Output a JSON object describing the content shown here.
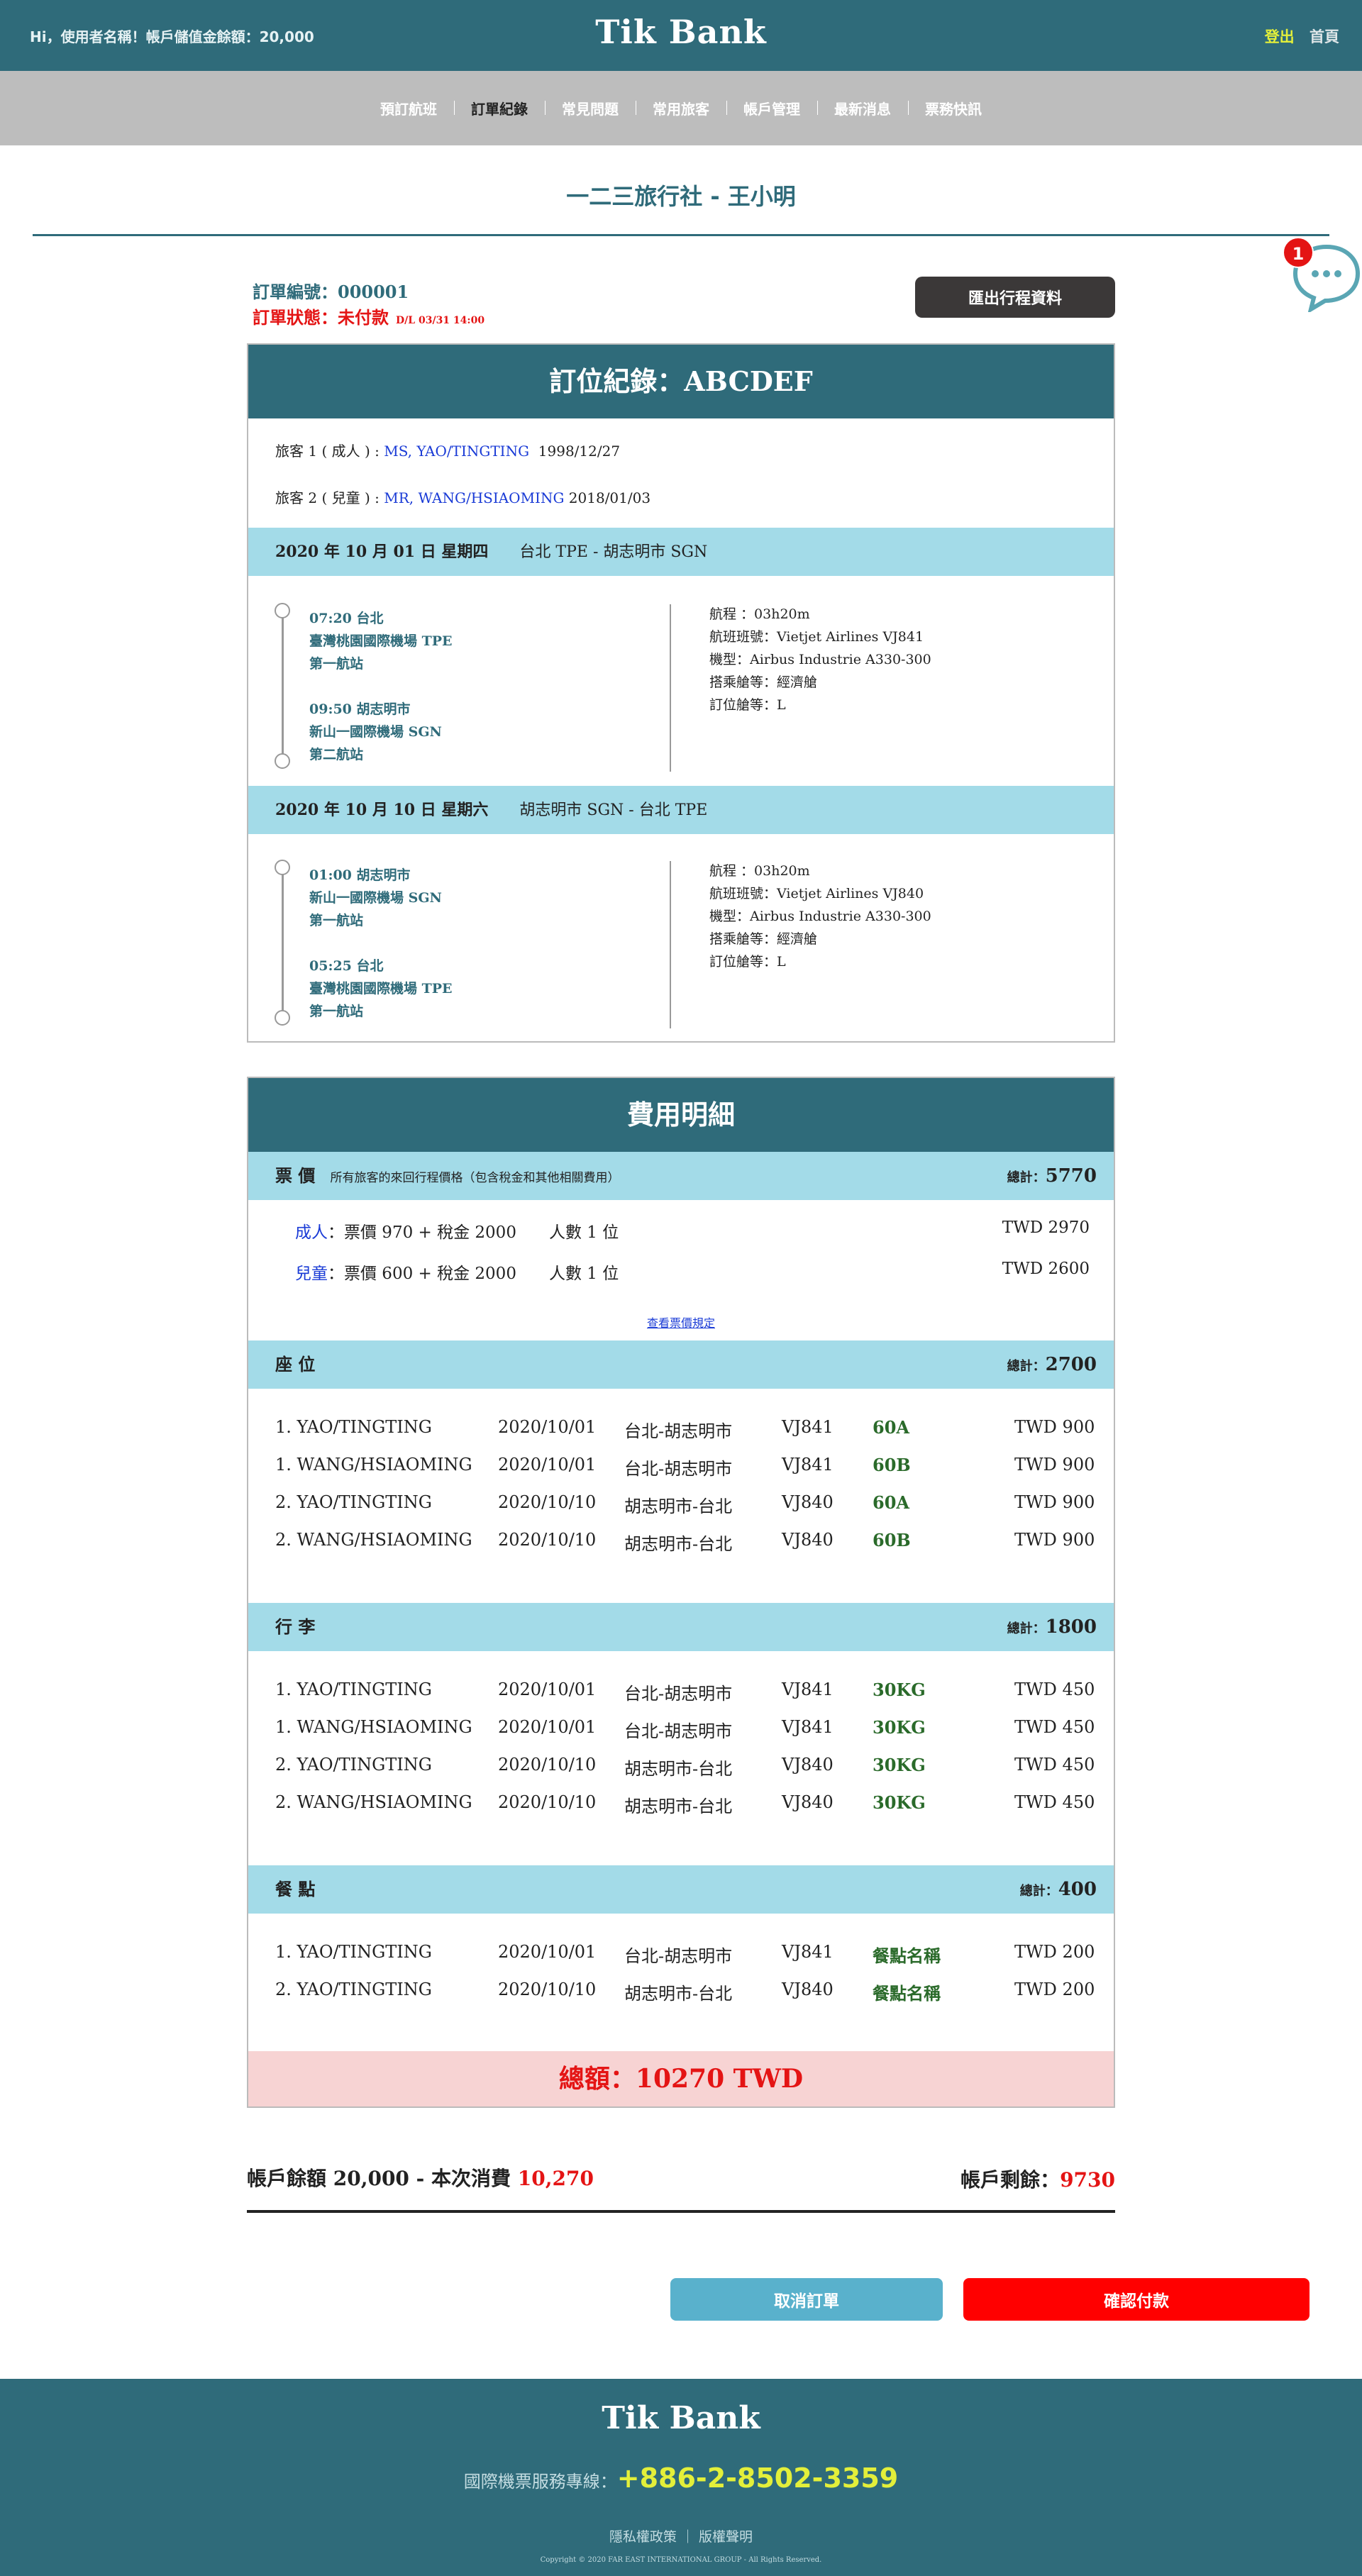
{
  "header": {
    "greeting": "Hi，使用者名稱！帳戶儲值金餘額：20,000",
    "logo": "Tik Bank",
    "logout": "登出",
    "home": "首頁"
  },
  "nav": [
    "預訂航班",
    "訂單紀錄",
    "常見問題",
    "常用旅客",
    "帳戶管理",
    "最新消息",
    "票務快訊"
  ],
  "nav_active": "訂單紀錄",
  "page_title": "一二三旅行社 - 王小明",
  "chat": {
    "badge": "1"
  },
  "order": {
    "number": "訂單編號：000001",
    "status": "訂單狀態：未付款",
    "deadline": "D/L 03/31 14:00",
    "export_button": "匯出行程資料"
  },
  "booking": {
    "title": "訂位紀錄：ABCDEF",
    "passengers": [
      {
        "label": "旅客 1 ( 成人 ) : ",
        "name": "MS, YAO/TINGTING",
        "dob": "1998/12/27"
      },
      {
        "label": "旅客 2 ( 兒童 ) : ",
        "name": "MR, WANG/HSIAOMING",
        "dob": "2018/01/03"
      }
    ],
    "segments": [
      {
        "date": "2020 年 10 月 01 日 星期四",
        "route": "台北 TPE - 胡志明市 SGN",
        "dep": {
          "time_city": "07:20 台北",
          "airport": "臺灣桃園國際機場 TPE",
          "terminal": "第一航站"
        },
        "arr": {
          "time_city": "09:50 胡志明市",
          "airport": "新山一國際機場 SGN",
          "terminal": "第二航站"
        },
        "info": [
          "航程 ：03h20m",
          "航班班號：Vietjet Airlines VJ841",
          "機型：Airbus Industrie A330-300",
          "搭乘艙等：經濟艙",
          "訂位艙等：L"
        ]
      },
      {
        "date": "2020 年 10 月 10 日 星期六",
        "route": "胡志明市 SGN - 台北 TPE",
        "dep": {
          "time_city": "01:00 胡志明市",
          "airport": "新山一國際機場 SGN",
          "terminal": "第一航站"
        },
        "arr": {
          "time_city": "05:25 台北",
          "airport": "臺灣桃園國際機場 TPE",
          "terminal": "第一航站"
        },
        "info": [
          "航程 ：03h20m",
          "航班班號：Vietjet Airlines VJ840",
          "機型：Airbus Industrie A330-300",
          "搭乘艙等：經濟艙",
          "訂位艙等：L"
        ]
      }
    ]
  },
  "costs": {
    "title": "費用明細",
    "total_label": "總計：",
    "fare": {
      "title": "票 價",
      "note": "所有旅客的來回行程價格（包含稅金和其他相關費用）",
      "total": "5770",
      "rows": [
        {
          "type": "成人",
          "detail": "：票價 970 + 稅金 2000　　人數 1 位",
          "amount": "TWD 2970"
        },
        {
          "type": "兒童",
          "detail": "：票價 600 + 稅金 2000　　人數 1 位",
          "amount": "TWD 2600"
        }
      ],
      "link": "查看票價規定"
    },
    "seat": {
      "title": "座 位",
      "total": "2700",
      "rows": [
        [
          "1. YAO/TINGTING",
          "2020/10/01",
          "台北-胡志明市",
          "VJ841",
          "60A",
          "TWD 900"
        ],
        [
          "1. WANG/HSIAOMING",
          "2020/10/01",
          "台北-胡志明市",
          "VJ841",
          "60B",
          "TWD 900"
        ],
        [
          "2. YAO/TINGTING",
          "2020/10/10",
          "胡志明市-台北",
          "VJ840",
          "60A",
          "TWD 900"
        ],
        [
          "2. WANG/HSIAOMING",
          "2020/10/10",
          "胡志明市-台北",
          "VJ840",
          "60B",
          "TWD 900"
        ]
      ]
    },
    "baggage": {
      "title": "行 李",
      "total": "1800",
      "rows": [
        [
          "1. YAO/TINGTING",
          "2020/10/01",
          "台北-胡志明市",
          "VJ841",
          "30KG",
          "TWD 450"
        ],
        [
          "1. WANG/HSIAOMING",
          "2020/10/01",
          "台北-胡志明市",
          "VJ841",
          "30KG",
          "TWD 450"
        ],
        [
          "2. YAO/TINGTING",
          "2020/10/10",
          "胡志明市-台北",
          "VJ840",
          "30KG",
          "TWD 450"
        ],
        [
          "2. WANG/HSIAOMING",
          "2020/10/10",
          "胡志明市-台北",
          "VJ840",
          "30KG",
          "TWD 450"
        ]
      ]
    },
    "meal": {
      "title": "餐 點",
      "total": "400",
      "rows": [
        [
          "1. YAO/TINGTING",
          "2020/10/01",
          "台北-胡志明市",
          "VJ841",
          "餐點名稱",
          "TWD 200"
        ],
        [
          "2. YAO/TINGTING",
          "2020/10/10",
          "胡志明市-台北",
          "VJ840",
          "餐點名稱",
          "TWD 200"
        ]
      ]
    },
    "grand_total": "總額：10270 TWD"
  },
  "balance": {
    "left_prefix": "帳戶餘額 20,000 - 本次消費 ",
    "spend": "10,270",
    "right_prefix": "帳戶剩餘：",
    "remaining": "9730"
  },
  "buttons": {
    "cancel": "取消訂單",
    "confirm": "確認付款"
  },
  "footer": {
    "logo": "Tik Bank",
    "phone_label": "國際機票服務專線：",
    "phone": "+886-2-8502-3359",
    "privacy": "隱私權政策",
    "sep": "｜",
    "copyright_link": "版權聲明",
    "copyright": "Copyright © 2020 FAR EAST INTERNATIONAL GROUP - All Rights Reserved."
  },
  "colors": {
    "brand": "#2f6b7a",
    "accent_yellow": "#e3ef3a",
    "alert_red": "#e41414",
    "band_blue": "#a3dbe8"
  }
}
